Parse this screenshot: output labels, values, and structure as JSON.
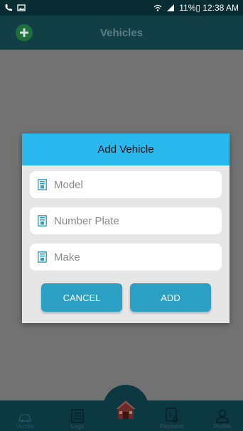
{
  "status_bar": {
    "right_text": "11%▯ 12:38 AM"
  },
  "app_bar": {
    "title": "Vehicles"
  },
  "dialog": {
    "title": "Add Vehicle",
    "fields": [
      {
        "placeholder": "Model",
        "value": ""
      },
      {
        "placeholder": "Number Plate",
        "value": ""
      },
      {
        "placeholder": "Make",
        "value": ""
      }
    ],
    "cancel_label": "CANCEL",
    "add_label": "ADD"
  },
  "bottom_nav": {
    "items": [
      {
        "label": "Vechile",
        "icon": "car-icon"
      },
      {
        "label": "Logs",
        "icon": "document-icon"
      },
      {
        "label": "",
        "icon": "home-icon"
      },
      {
        "label": "Payment",
        "icon": "invoice-icon"
      },
      {
        "label": "Profile",
        "icon": "person-icon"
      }
    ]
  },
  "colors": {
    "status_bar": "#0a2c33",
    "app_bar": "#123e45",
    "dialog_header": "#29b8ee",
    "button": "#2b9fc4",
    "bottom_nav": "#0b3841"
  }
}
